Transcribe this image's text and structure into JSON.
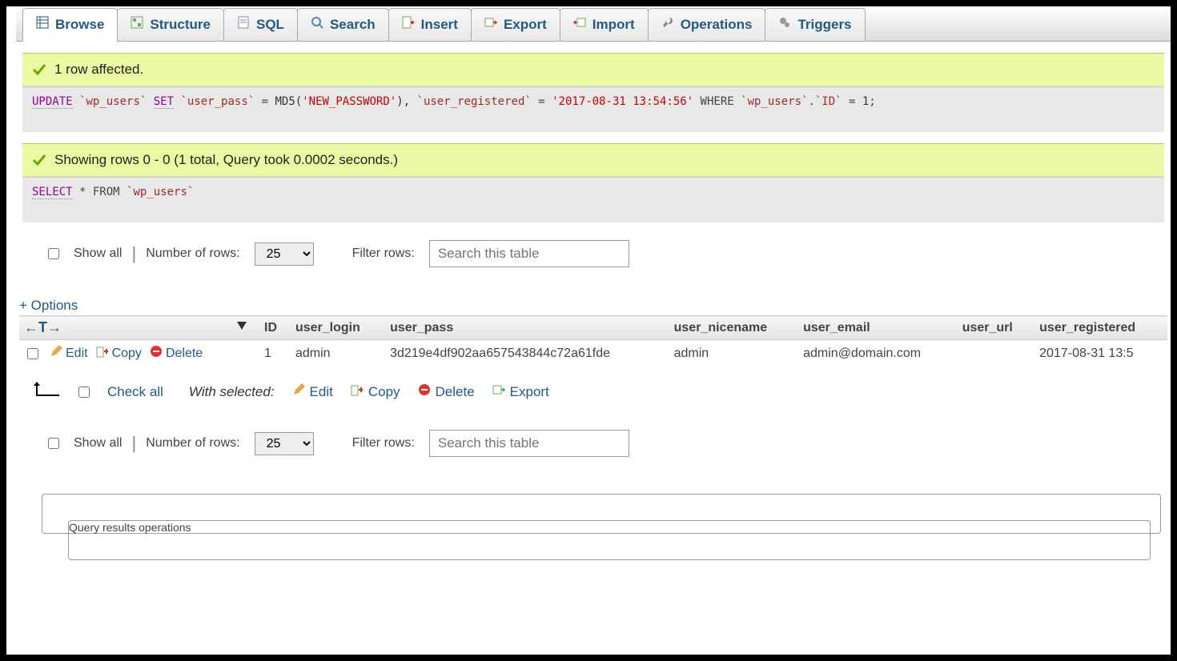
{
  "tabs": {
    "browse": "Browse",
    "structure": "Structure",
    "sql": "SQL",
    "search": "Search",
    "insert": "Insert",
    "export": "Export",
    "import": "Import",
    "operations": "Operations",
    "triggers": "Triggers"
  },
  "notice1": {
    "message": "1 row affected.",
    "sql": {
      "kw_update": "UPDATE",
      "tbl1": "`wp_users`",
      "kw_set": "SET",
      "col_pass": "`user_pass`",
      "eq1": " = ",
      "func_md5_open": "MD5(",
      "md5_arg": "'NEW_PASSWORD'",
      "func_md5_close": "),",
      "col_reg": " `user_registered`",
      "eq2": " = ",
      "date_str": "'2017-08-31 13:54:56'",
      "kw_where": " WHERE ",
      "tbl2": "`wp_users`",
      "dot": ".",
      "col_id": "`ID`",
      "eq3": " = ",
      "val1": "1",
      "semi": ";"
    }
  },
  "notice2": {
    "message": "Showing rows 0 - 0 (1 total, Query took 0.0002 seconds.)",
    "sql": {
      "kw_select": "SELECT",
      "star": " * ",
      "kw_from": "FROM",
      "tbl": " `wp_users`"
    }
  },
  "controls": {
    "show_all": "Show all",
    "num_rows_label": "Number of rows:",
    "num_rows_value": "25",
    "filter_label": "Filter rows:",
    "filter_placeholder": "Search this table"
  },
  "options_link": "+ Options",
  "table": {
    "headers": {
      "id": "ID",
      "user_login": "user_login",
      "user_pass": "user_pass",
      "user_nicename": "user_nicename",
      "user_email": "user_email",
      "user_url": "user_url",
      "user_registered": "user_registered"
    },
    "row_actions": {
      "edit": "Edit",
      "copy": "Copy",
      "delete": "Delete"
    },
    "rows": [
      {
        "ID": "1",
        "user_login": "admin",
        "user_pass": "3d219e4df902aa657543844c72a61fde",
        "user_nicename": "admin",
        "user_email": "admin@domain.com",
        "user_url": "",
        "user_registered": "2017-08-31 13:5"
      }
    ]
  },
  "bulk": {
    "check_all": "Check all",
    "with_selected": "With selected:",
    "edit": "Edit",
    "copy": "Copy",
    "delete": "Delete",
    "export": "Export"
  },
  "qro": {
    "title": "Query results operations"
  },
  "arrows_header": "←T→"
}
